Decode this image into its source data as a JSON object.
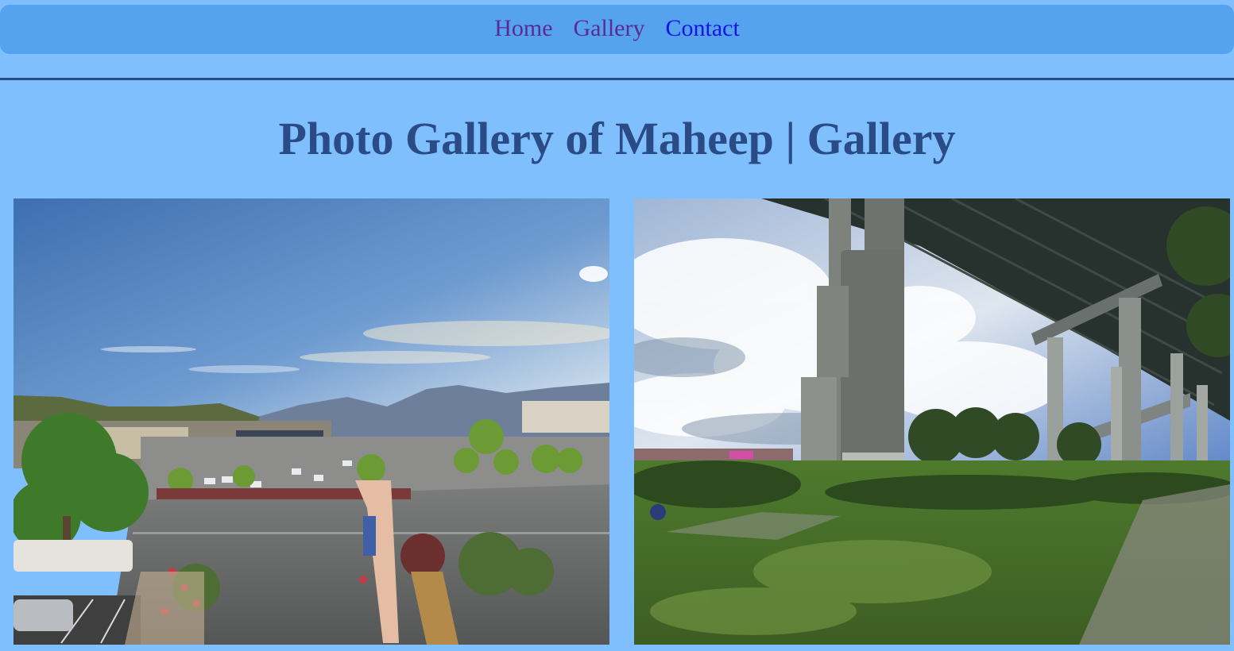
{
  "nav": {
    "items": [
      {
        "label": "Home",
        "state": "visited"
      },
      {
        "label": "Gallery",
        "state": "visited"
      },
      {
        "label": "Contact",
        "state": "link"
      }
    ]
  },
  "page": {
    "title": "Photo Gallery of Maheep | Gallery"
  },
  "gallery": {
    "photos": [
      {
        "subject": "town-valley-parking-lot-photo"
      },
      {
        "subject": "highway-bridge-underside-photo"
      }
    ]
  },
  "colors": {
    "background": "#80bffe",
    "nav_bar": "#55a3ee",
    "title": "#2b4b86",
    "visited_link": "#5b2b94",
    "link": "#1414e8"
  }
}
